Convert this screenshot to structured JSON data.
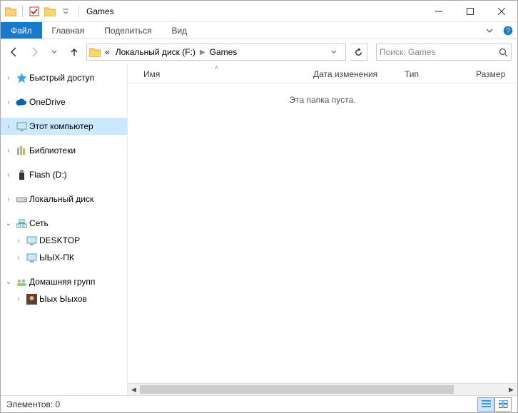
{
  "window": {
    "title": "Games"
  },
  "ribbon": {
    "file": "Файл",
    "tabs": [
      "Главная",
      "Поделиться",
      "Вид"
    ]
  },
  "address": {
    "prefix": "«",
    "crumbs": [
      "Локальный диск (F:)",
      "Games"
    ]
  },
  "search": {
    "placeholder": "Поиск: Games"
  },
  "columns": {
    "name": "Имя",
    "date": "Дата изменения",
    "type": "Тип",
    "size": "Размер"
  },
  "empty_text": "Эта папка пуста.",
  "nav": {
    "quick": "Быстрый доступ",
    "onedrive": "OneDrive",
    "thispc": "Этот компьютер",
    "libraries": "Библиотеки",
    "flash": "Flash (D:)",
    "localdisk": "Локальный диск",
    "network": "Сеть",
    "net1": "DESKTOP",
    "net2": "ЫЫХ-ПК",
    "homegroup": "Домашняя групп",
    "hguser": "Ыых Ыыхов"
  },
  "status": {
    "items": "Элементов: 0"
  },
  "colors": {
    "accent": "#1979ca",
    "selection": "#cce8ff"
  }
}
